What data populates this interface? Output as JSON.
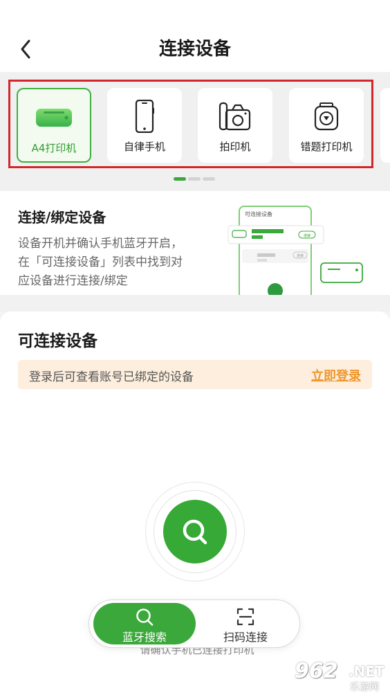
{
  "header": {
    "title": "连接设备"
  },
  "devices": [
    {
      "label": "A4打印机",
      "icon": "a4-printer-icon",
      "selected": true
    },
    {
      "label": "自律手机",
      "icon": "phone-icon",
      "selected": false
    },
    {
      "label": "拍印机",
      "icon": "camera-printer-icon",
      "selected": false
    },
    {
      "label": "错题打印机",
      "icon": "mistake-printer-icon",
      "selected": false
    }
  ],
  "pager": {
    "pages": 3,
    "active": 1
  },
  "info": {
    "title": "连接/绑定设备",
    "description": "设备开机并确认手机蓝牙开启，在「可连接设备」列表中找到对应设备进行连接/绑定",
    "illustration": {
      "card_title": "可连接设备",
      "chip1": "连接",
      "chip2": "连接"
    }
  },
  "connectable": {
    "title": "可连接设备",
    "notice_text": "登录后可查看账号已绑定的设备",
    "login_link": "立即登录"
  },
  "search": {
    "icon": "search-icon"
  },
  "bottom_tabs": {
    "bluetooth_label": "蓝牙搜索",
    "qr_label": "扫码连接",
    "hint_text": "请确认手机已连接打印机"
  },
  "watermark": {
    "number": "962",
    "suffix": ".NET",
    "sub": "乐游网"
  },
  "colors": {
    "accent": "#37a937",
    "highlight_frame": "#d3262a",
    "login_link": "#f0962a",
    "notice_bg": "#fdeedd"
  }
}
